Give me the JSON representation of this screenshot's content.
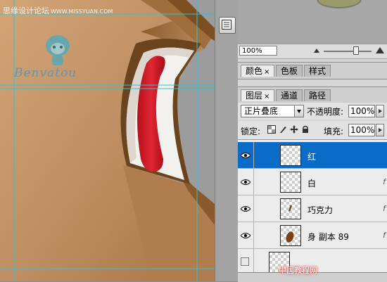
{
  "watermark": {
    "top_text": "思缘设计论坛",
    "top_url": "WWW.MISSYUAN.COM",
    "bottom_text": "中国教程网"
  },
  "canvas": {
    "logo_text": "Benvatou",
    "colors": {
      "wood_light": "#c39567",
      "wood_dark": "#8a5a2b",
      "red": "#cc1a25",
      "inset_white": "#f3f1ee",
      "guide": "#27c6d8"
    }
  },
  "dock": {
    "icon": "panel-options-icon"
  },
  "navigator": {
    "zoom_value": "100%"
  },
  "color_tabs": [
    {
      "label": "颜色",
      "close": "×",
      "active": true
    },
    {
      "label": "色板",
      "active": false
    },
    {
      "label": "样式",
      "active": false
    }
  ],
  "layer_tabs": [
    {
      "label": "图层",
      "close": "×",
      "active": true
    },
    {
      "label": "通道",
      "active": false
    },
    {
      "label": "路径",
      "active": false
    }
  ],
  "layers_panel": {
    "blend_mode": "正片叠底",
    "opacity_label": "不透明度:",
    "opacity_value": "100%",
    "lock_label": "锁定:",
    "fill_label": "填充:",
    "fill_value": "100%",
    "layers": [
      {
        "name": "红",
        "selected": true,
        "visible": true,
        "fx": ""
      },
      {
        "name": "白",
        "selected": false,
        "visible": true,
        "fx": "f"
      },
      {
        "name": "巧克力",
        "selected": false,
        "visible": true,
        "fx": "f"
      },
      {
        "name": "身 副本 89",
        "selected": false,
        "visible": true,
        "fx": "f"
      }
    ]
  }
}
